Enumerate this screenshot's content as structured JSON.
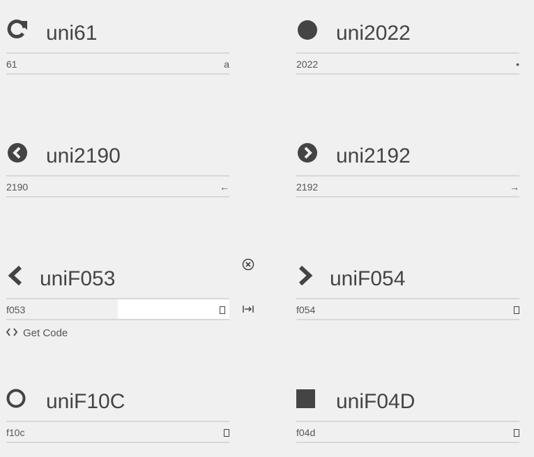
{
  "glyphs": [
    {
      "name": "uni61",
      "hex": "61",
      "char": "a",
      "icon": "refresh-icon"
    },
    {
      "name": "uni2022",
      "hex": "2022",
      "char": "•",
      "icon": "circle-filled-icon"
    },
    {
      "name": "uni2190",
      "hex": "2190",
      "char": "←",
      "icon": "circle-chevron-left-icon"
    },
    {
      "name": "uni2192",
      "hex": "2192",
      "char": "→",
      "icon": "circle-chevron-right-icon"
    },
    {
      "name": "uniF053",
      "hex": "f053",
      "char": "",
      "icon": "chevron-left-icon"
    },
    {
      "name": "uniF054",
      "hex": "f054",
      "char": "",
      "icon": "chevron-right-icon"
    },
    {
      "name": "uniF10C",
      "hex": "f10c",
      "char": "",
      "icon": "circle-outline-icon"
    },
    {
      "name": "uniF04D",
      "hex": "f04d",
      "char": "",
      "icon": "square-filled-icon"
    }
  ],
  "actions": {
    "get_code_label": "Get Code"
  },
  "colors": {
    "icon": "#444444",
    "background": "#f0f0f0",
    "divider": "#d8d8d8"
  }
}
